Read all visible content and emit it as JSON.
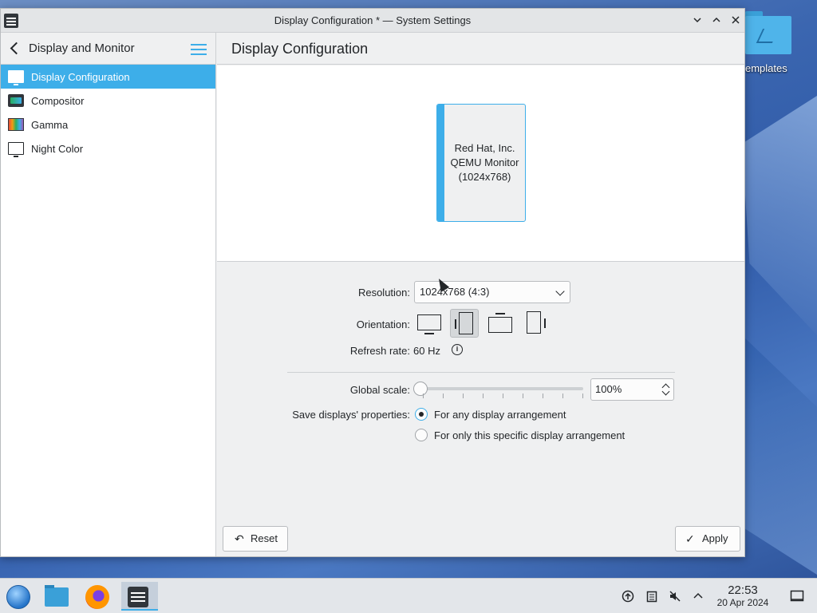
{
  "window": {
    "title": "Display Configuration * — System Settings",
    "controls": [
      "minimize",
      "maximize",
      "close"
    ]
  },
  "sidebar": {
    "header": "Display and Monitor",
    "items": [
      {
        "label": "Display Configuration",
        "icon": "monitor-icon",
        "active": true
      },
      {
        "label": "Compositor",
        "icon": "compositor-icon",
        "active": false
      },
      {
        "label": "Gamma",
        "icon": "gamma-icon",
        "active": false
      },
      {
        "label": "Night Color",
        "icon": "monitor-icon",
        "active": false
      }
    ]
  },
  "main": {
    "title": "Display Configuration",
    "screen": {
      "line1": "Red Hat, Inc.",
      "line2": "QEMU Monitor",
      "line3": "(1024x768)"
    },
    "resolution": {
      "label": "Resolution:",
      "value": "1024x768 (4:3)"
    },
    "orientation": {
      "label": "Orientation:",
      "options": [
        "landscape",
        "portrait-left",
        "landscape-flipped",
        "portrait-right"
      ],
      "selected": 1
    },
    "refresh": {
      "label": "Refresh rate:",
      "value": "60 Hz"
    },
    "scale": {
      "label": "Global scale:",
      "value": "100%",
      "slider_fraction": 0
    },
    "save_props": {
      "label": "Save displays' properties:",
      "options": [
        {
          "label": "For any display arrangement",
          "checked": true
        },
        {
          "label": "For only this specific display arrangement",
          "checked": false
        }
      ]
    },
    "buttons": {
      "reset": "Reset",
      "apply": "Apply"
    }
  },
  "desktop": {
    "folder_label": "emplates"
  },
  "taskbar": {
    "apps": [
      "start-menu-icon",
      "file-manager-icon",
      "firefox-icon",
      "system-settings-icon"
    ],
    "active_app": "system-settings-icon",
    "tray": [
      "updates-icon",
      "clipboard-icon",
      "volume-muted-icon",
      "tray-expand-icon"
    ],
    "time": "22:53",
    "date": "20 Apr 2024"
  },
  "colors": {
    "accent": "#3daee9",
    "window_bg": "#eff0f1",
    "text": "#232629"
  }
}
